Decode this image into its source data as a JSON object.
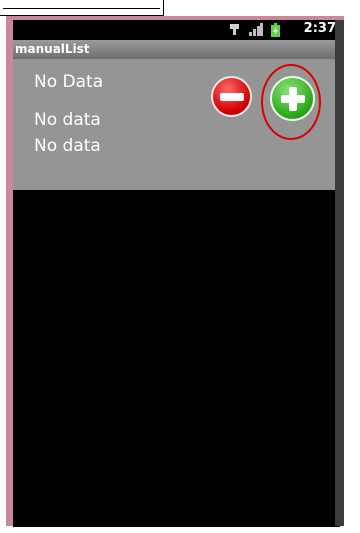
{
  "statusbar": {
    "time": "2:37",
    "icons": [
      "usb-icon",
      "signal-icon",
      "battery-icon"
    ]
  },
  "app": {
    "title": "manualList"
  },
  "list": {
    "items": [
      "No Data",
      "No data",
      "No data"
    ]
  },
  "buttons": {
    "remove_icon": "minus-icon",
    "add_icon": "plus-icon"
  },
  "colors": {
    "title_bar": "#7f7f7f",
    "list_background": "#959595",
    "remove": "#d40000",
    "add": "#2faa1d",
    "highlight": "#d80000",
    "phone_frame": "#c98899"
  }
}
